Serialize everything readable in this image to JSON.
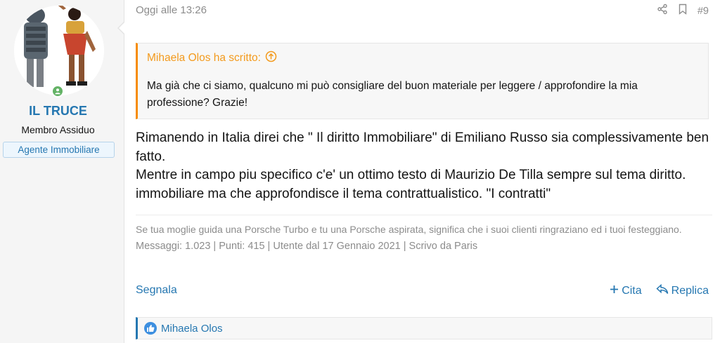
{
  "user": {
    "name": "IL TRUCE",
    "title": "Membro Assiduo",
    "banner": "Agente Immobiliare"
  },
  "post": {
    "date": "Oggi alle 13:26",
    "number": "#9",
    "share_icon": "share-icon",
    "bookmark_icon": "bookmark-icon"
  },
  "quote": {
    "author": "Mihaela Olos ha scritto:",
    "text": "Ma già che ci siamo, qualcuno mi può consigliare del buon materiale per leggere / approfondire la mia professione? Grazie!"
  },
  "message": {
    "line1": "Rimanendo in Italia direi che \" Il diritto Immobiliare\" di Emiliano Russo sia complessivamente ben fatto.",
    "line2": "Mentre in campo piu specifico c'e' un ottimo testo di Maurizio De Tilla sempre sul tema diritto. immobiliare ma che approfondisce il tema contrattualistico. \"I contratti\""
  },
  "signature": {
    "text": "Se tua moglie guida una Porsche Turbo e tu una Porsche aspirata, significa che i suoi clienti ringraziano ed i tuoi festeggiano.",
    "stats": "Messaggi: 1.023 | Punti: 415 | Utente dal 17 Gennaio 2021 | Scrivo da Paris"
  },
  "actions": {
    "report": "Segnala",
    "quote": "Cita",
    "reply": "Replica"
  },
  "reactions": {
    "users": "Mihaela Olos"
  },
  "colors": {
    "accent": "#2577b1",
    "quote_border": "#f78c00",
    "online": "#63b265"
  }
}
